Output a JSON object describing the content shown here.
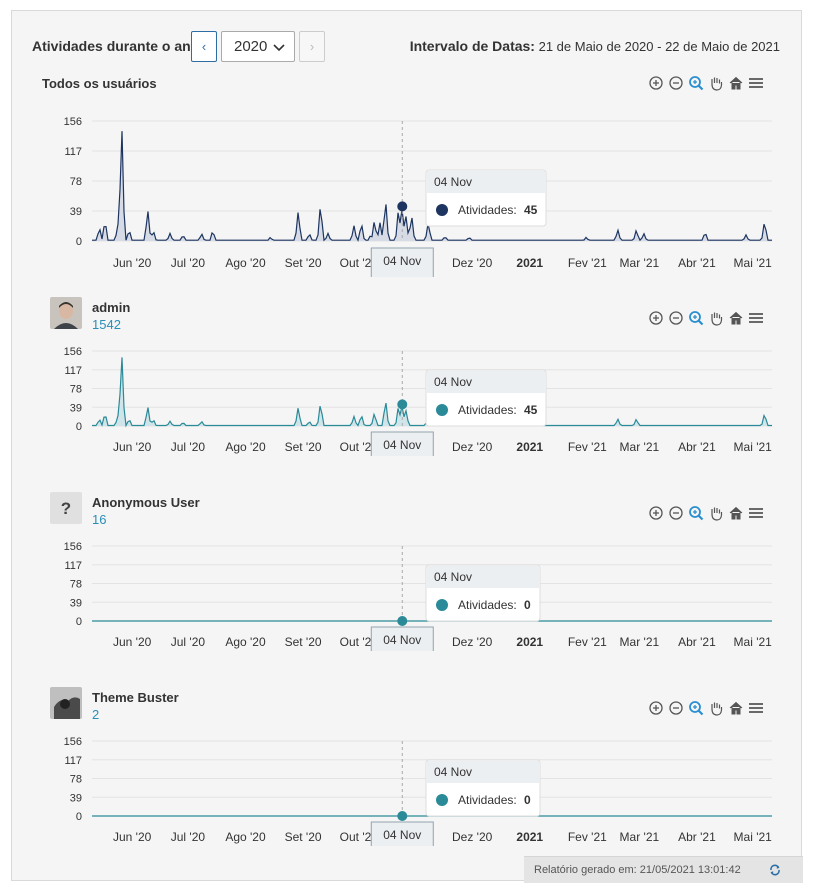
{
  "header": {
    "title": "Atividades durante o ano",
    "prev_label": "‹",
    "next_label": "›",
    "year": "2020",
    "interval_label": "Intervalo de Datas:",
    "interval_value": "21 de Maio de 2020 - 22 de Maio de 2021"
  },
  "colors": {
    "accent": "#2a8fb7",
    "dark_series": "#1d3560",
    "teal_series": "#2b8a98"
  },
  "months": [
    "Jun '20",
    "Jul '20",
    "Ago '20",
    "Set '20",
    "Out '20",
    "Nov '20",
    "Dez '20",
    "2021",
    "Fev '21",
    "Mar '21",
    "Abr '21",
    "Mai '21"
  ],
  "tooltip": {
    "date": "04 Nov",
    "label": "Atividades:"
  },
  "charts": [
    {
      "title": "Todos os usuários",
      "value": "45"
    },
    {
      "name": "admin",
      "count": "1542",
      "value": "45"
    },
    {
      "name": "Anonymous User",
      "count": "16",
      "value": "0"
    },
    {
      "name": "Theme Buster",
      "count": "2",
      "value": "0"
    }
  ],
  "chart_data": [
    {
      "type": "area",
      "title": "Todos os usuários",
      "ylim": [
        0,
        156
      ],
      "yticks": [
        0,
        39,
        78,
        117,
        156
      ],
      "x_range": [
        "2020-05-21",
        "2021-05-22"
      ],
      "peaks": [
        {
          "x": "2020-05-25",
          "y": 18
        },
        {
          "x": "2020-05-28",
          "y": 28
        },
        {
          "x": "2020-06-04",
          "y": 22
        },
        {
          "x": "2020-06-06",
          "y": 157
        },
        {
          "x": "2020-06-10",
          "y": 15
        },
        {
          "x": "2020-06-20",
          "y": 42
        },
        {
          "x": "2020-06-23",
          "y": 14
        },
        {
          "x": "2020-07-02",
          "y": 10
        },
        {
          "x": "2020-07-09",
          "y": 8
        },
        {
          "x": "2020-07-19",
          "y": 10
        },
        {
          "x": "2020-07-25",
          "y": 14
        },
        {
          "x": "2020-08-25",
          "y": 5
        },
        {
          "x": "2020-09-09",
          "y": 40
        },
        {
          "x": "2020-09-15",
          "y": 10
        },
        {
          "x": "2020-09-21",
          "y": 50
        },
        {
          "x": "2020-09-25",
          "y": 10
        },
        {
          "x": "2020-10-09",
          "y": 20
        },
        {
          "x": "2020-10-13",
          "y": 24
        },
        {
          "x": "2020-10-18",
          "y": 8
        },
        {
          "x": "2020-10-20",
          "y": 28
        },
        {
          "x": "2020-10-23",
          "y": 24
        },
        {
          "x": "2020-10-26",
          "y": 56
        },
        {
          "x": "2020-11-02",
          "y": 45
        },
        {
          "x": "2020-11-04",
          "y": 45
        },
        {
          "x": "2020-11-06",
          "y": 32
        },
        {
          "x": "2020-11-09",
          "y": 35
        },
        {
          "x": "2020-11-18",
          "y": 25
        },
        {
          "x": "2020-11-27",
          "y": 6
        },
        {
          "x": "2020-12-10",
          "y": 5
        },
        {
          "x": "2021-02-11",
          "y": 5
        },
        {
          "x": "2021-02-28",
          "y": 15
        },
        {
          "x": "2021-03-10",
          "y": 15
        },
        {
          "x": "2021-03-14",
          "y": 10
        },
        {
          "x": "2021-04-16",
          "y": 12
        },
        {
          "x": "2021-05-08",
          "y": 8
        },
        {
          "x": "2021-05-18",
          "y": 27
        }
      ]
    },
    {
      "type": "area",
      "title": "admin",
      "ylim": [
        0,
        156
      ],
      "yticks": [
        0,
        39,
        78,
        117,
        156
      ],
      "x_range": [
        "2020-05-21",
        "2021-05-22"
      ],
      "peaks": [
        {
          "x": "2020-05-25",
          "y": 15
        },
        {
          "x": "2020-05-28",
          "y": 28
        },
        {
          "x": "2020-06-04",
          "y": 22
        },
        {
          "x": "2020-06-06",
          "y": 157
        },
        {
          "x": "2020-06-10",
          "y": 15
        },
        {
          "x": "2020-06-20",
          "y": 42
        },
        {
          "x": "2020-06-23",
          "y": 14
        },
        {
          "x": "2020-07-02",
          "y": 10
        },
        {
          "x": "2020-07-09",
          "y": 8
        },
        {
          "x": "2020-07-19",
          "y": 10
        },
        {
          "x": "2020-09-09",
          "y": 40
        },
        {
          "x": "2020-09-15",
          "y": 10
        },
        {
          "x": "2020-09-21",
          "y": 50
        },
        {
          "x": "2020-10-09",
          "y": 20
        },
        {
          "x": "2020-10-13",
          "y": 24
        },
        {
          "x": "2020-10-20",
          "y": 28
        },
        {
          "x": "2020-10-26",
          "y": 56
        },
        {
          "x": "2020-11-02",
          "y": 45
        },
        {
          "x": "2020-11-04",
          "y": 45
        },
        {
          "x": "2020-11-06",
          "y": 32
        },
        {
          "x": "2020-11-18",
          "y": 25
        },
        {
          "x": "2021-02-28",
          "y": 15
        },
        {
          "x": "2021-03-10",
          "y": 15
        },
        {
          "x": "2021-05-18",
          "y": 27
        }
      ]
    },
    {
      "type": "area",
      "title": "Anonymous User",
      "ylim": [
        0,
        156
      ],
      "yticks": [
        0,
        39,
        78,
        117,
        156
      ],
      "x_range": [
        "2020-05-21",
        "2021-05-22"
      ],
      "peaks": []
    },
    {
      "type": "area",
      "title": "Theme Buster",
      "ylim": [
        0,
        156
      ],
      "yticks": [
        0,
        39,
        78,
        117,
        156
      ],
      "x_range": [
        "2020-05-21",
        "2021-05-22"
      ],
      "peaks": []
    }
  ],
  "footer": {
    "text": "Relatório gerado em: 21/05/2021 13:01:42"
  }
}
